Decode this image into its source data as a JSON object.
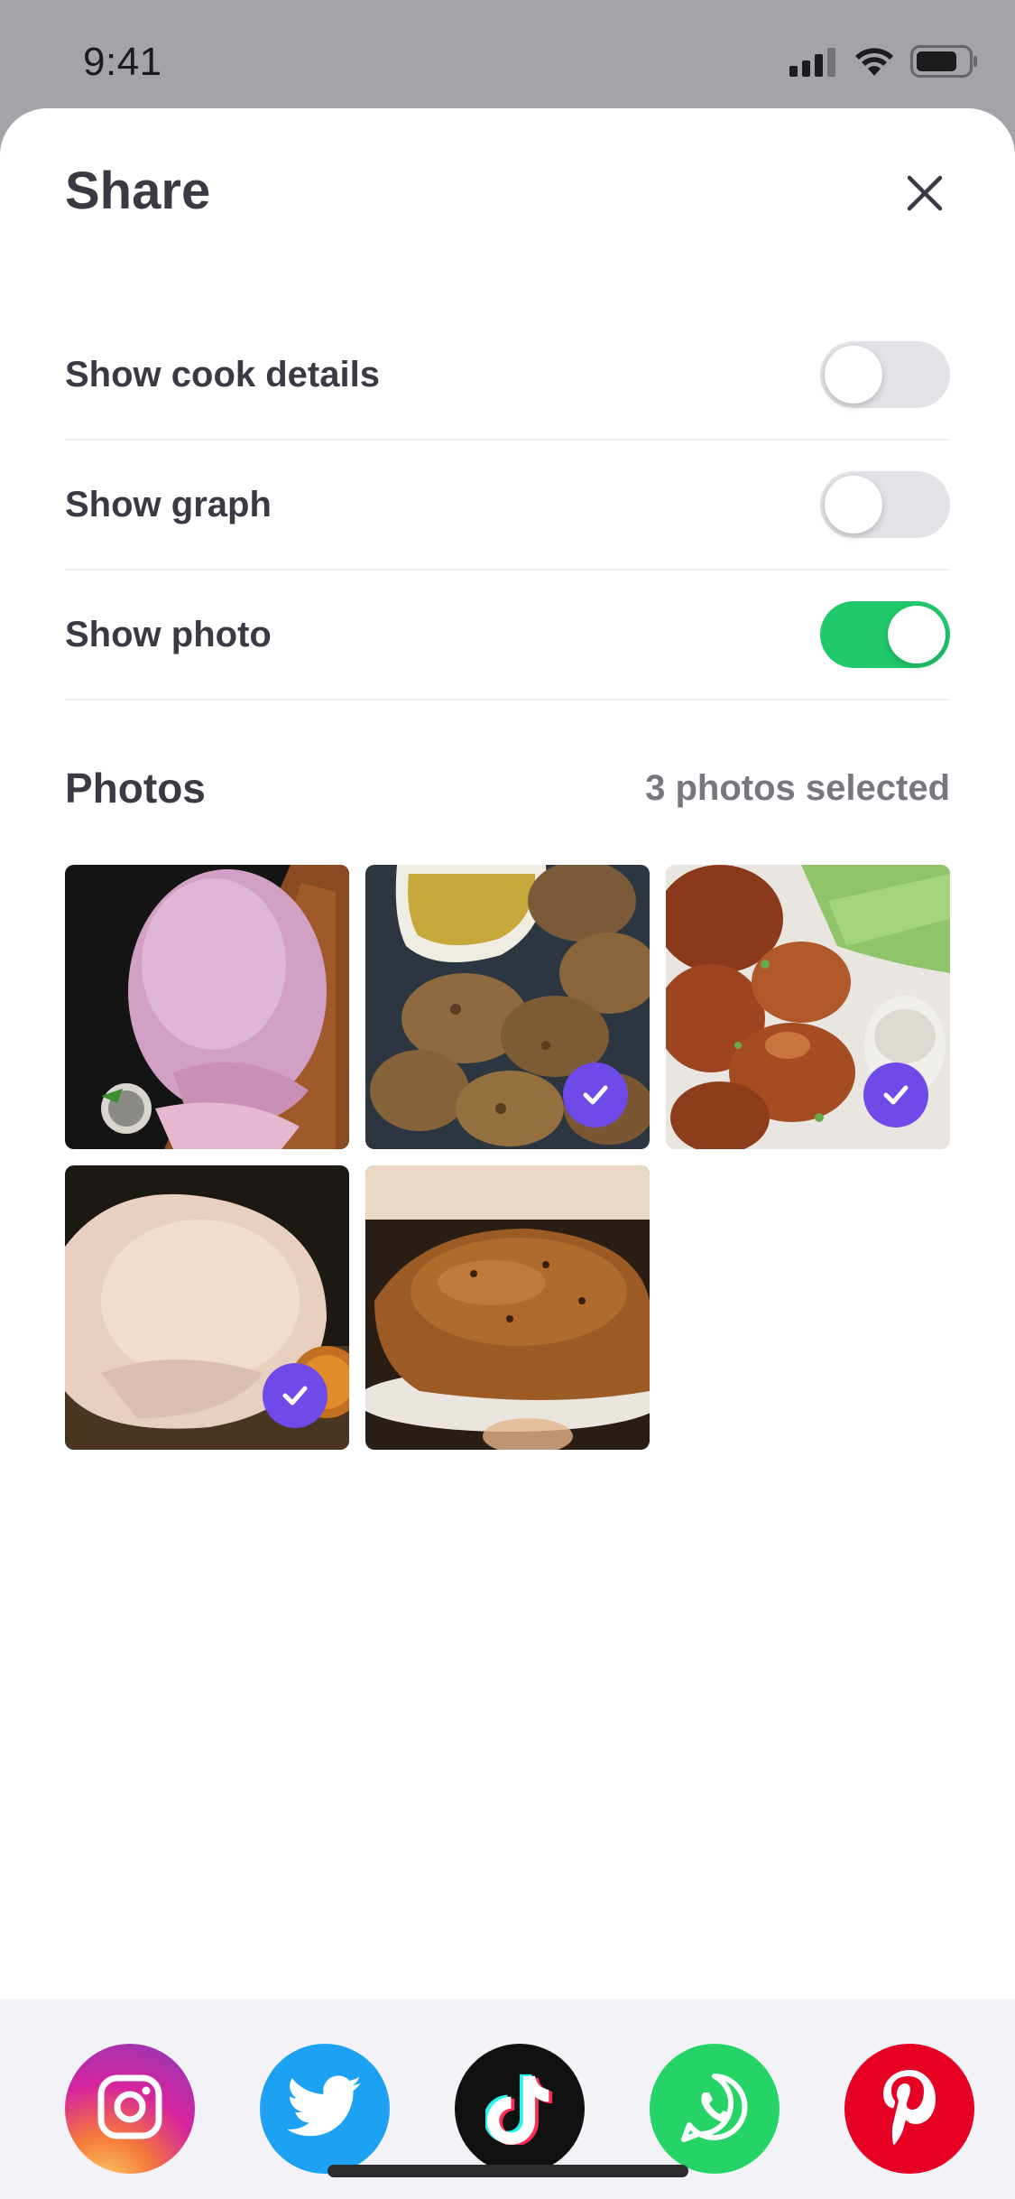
{
  "status_bar": {
    "time": "9:41",
    "icons": [
      "cellular-signal-icon",
      "wifi-icon",
      "battery-icon"
    ]
  },
  "sheet": {
    "title": "Share",
    "close_icon": "close-icon",
    "settings": [
      {
        "label": "Show cook details",
        "enabled": false
      },
      {
        "label": "Show graph",
        "enabled": false
      },
      {
        "label": "Show photo",
        "enabled": true
      }
    ],
    "photos": {
      "title": "Photos",
      "count_label": "3 photos selected",
      "items": [
        {
          "subject": "raw turkey breast on wooden board",
          "selected": false
        },
        {
          "subject": "fried chicken with dipping sauce",
          "selected": true
        },
        {
          "subject": "glazed chicken wings with ranch",
          "selected": true
        },
        {
          "subject": "raw whole chicken",
          "selected": true
        },
        {
          "subject": "roasted whole chicken",
          "selected": false
        }
      ]
    },
    "share_targets": [
      "instagram-icon",
      "twitter-icon",
      "tiktok-icon",
      "whatsapp-icon",
      "pinterest-icon"
    ]
  },
  "colors": {
    "accent_check": "#6e4be8",
    "toggle_on": "#20c96b",
    "toggle_off": "#e3e3e7",
    "text_primary": "#3a3a44",
    "text_secondary": "#77777f"
  }
}
